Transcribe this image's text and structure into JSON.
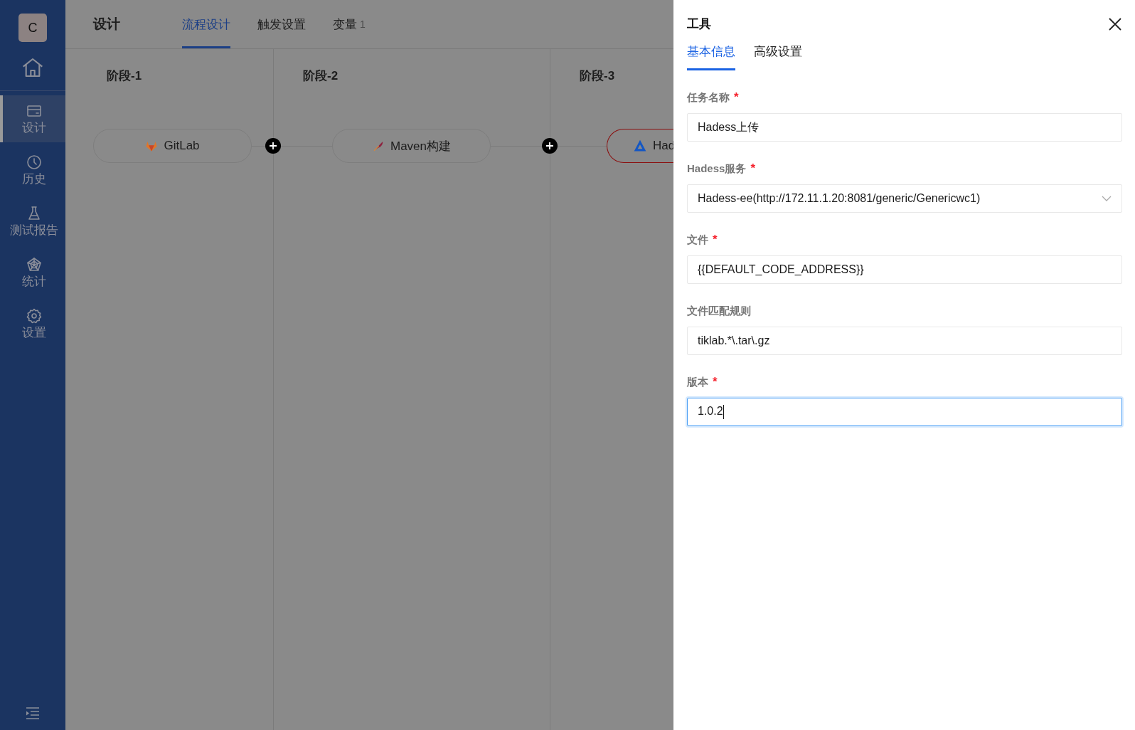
{
  "sidebar": {
    "avatar": "C",
    "items": [
      {
        "label": "设计",
        "selected": true
      },
      {
        "label": "历史",
        "selected": false
      },
      {
        "label": "测试报告",
        "selected": false
      },
      {
        "label": "统计",
        "selected": false
      },
      {
        "label": "设置",
        "selected": false
      }
    ]
  },
  "header": {
    "title": "设计",
    "tabs": [
      {
        "label": "流程设计",
        "selected": true
      },
      {
        "label": "触发设置",
        "selected": false
      },
      {
        "label": "变量",
        "count": "1",
        "selected": false
      }
    ]
  },
  "stages": [
    {
      "title": "阶段-1",
      "node": {
        "label": "GitLab",
        "selected": false
      }
    },
    {
      "title": "阶段-2",
      "node": {
        "label": "Maven构建",
        "selected": false
      }
    },
    {
      "title": "阶段-3",
      "node": {
        "label": "Had",
        "selected": true
      }
    }
  ],
  "drawer": {
    "title": "工具",
    "tabs": [
      {
        "label": "基本信息",
        "selected": true
      },
      {
        "label": "高级设置",
        "selected": false
      }
    ],
    "fields": [
      {
        "label": "任务名称",
        "required_mark": "*",
        "kind": "input",
        "value": "Hadess上传",
        "focused": false
      },
      {
        "label": "Hadess服务",
        "required_mark": "*",
        "kind": "select",
        "value": "Hadess-ee(http://172.11.1.20:8081/generic/Genericwc1)",
        "focused": false
      },
      {
        "label": "文件",
        "required_mark": "*",
        "kind": "input",
        "value": "{{DEFAULT_CODE_ADDRESS}}",
        "focused": false
      },
      {
        "label": "文件匹配规则",
        "kind": "input",
        "value": "tiklab.*\\.tar\\.gz",
        "focused": false
      },
      {
        "label": "版本",
        "required_mark": "*",
        "kind": "input",
        "value": "1.0.2",
        "focused": true
      }
    ]
  }
}
